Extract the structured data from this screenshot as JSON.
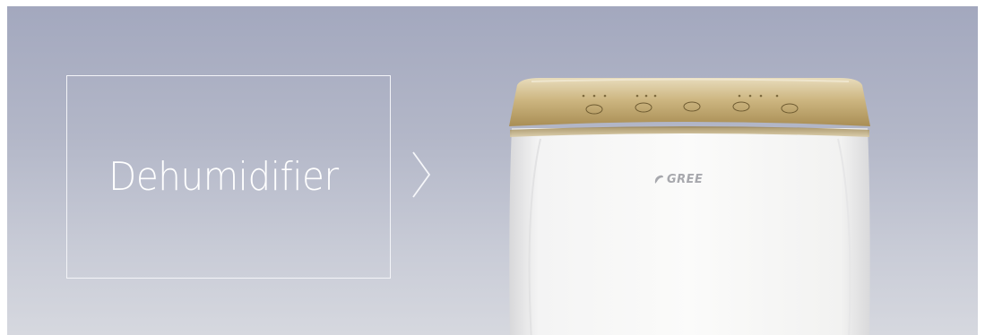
{
  "banner": {
    "title": "Dehumidifier",
    "brand": "GREE"
  },
  "icons": {
    "next": "chevron-right-icon",
    "brand_logo": "gree-leaf-logo-icon"
  },
  "colors": {
    "background_top": "#a3a8be",
    "background_bottom": "#d6d8df",
    "frame": "#f3f4f8",
    "product_body": "#f5f4f1",
    "product_top": "#c9b27a"
  }
}
